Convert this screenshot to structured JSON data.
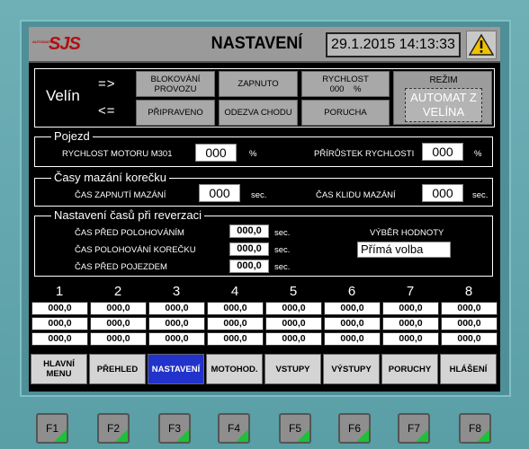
{
  "header": {
    "logo_text": "SJS",
    "logo_small": "AUTOMATION",
    "title": "NASTAVENÍ",
    "datetime": "29.1.2015 14:13:33"
  },
  "control": {
    "velin": "Velín",
    "arrow_right": "=>",
    "arrow_left": "<=",
    "buttons": {
      "blokovani": "BLOKOVÁNÍ PROVOZU",
      "zapnuto": "ZAPNUTO",
      "rychlost_label": "RYCHLOST",
      "rychlost_value": "000",
      "rychlost_unit": "%",
      "pripraveno": "PŘIPRAVENO",
      "odezva": "ODEZVA CHODU",
      "porucha": "PORUCHA"
    },
    "rezim_label": "REŽIM",
    "rezim_value": "AUTOMAT Z VELÍNA"
  },
  "pojezd": {
    "title": "Pojezd",
    "rychlost_label": "RYCHLOST MOTORU M301",
    "rychlost_value": "000",
    "rychlost_unit": "%",
    "prirustek_label": "PŘÍRŮSTEK RYCHLOSTI",
    "prirustek_value": "000",
    "prirustek_unit": "%"
  },
  "casy_mazani": {
    "title": "Časy mazání korečku",
    "zapnuti_label": "ČAS ZAPNUTÍ MAZÁNÍ",
    "zapnuti_value": "000",
    "zapnuti_unit": "sec.",
    "klidu_label": "ČAS KLIDU MAZÁNÍ",
    "klidu_value": "000",
    "klidu_unit": "sec."
  },
  "reverzace": {
    "title": "Nastavení časů při reverzaci",
    "rows": [
      {
        "label": "ČAS PŘED POLOHOVÁNÍM",
        "value": "000,0",
        "unit": "sec."
      },
      {
        "label": "ČAS POLOHOVÁNÍ KOREČKU",
        "value": "000,0",
        "unit": "sec."
      },
      {
        "label": "ČAS PŘED POJEZDEM",
        "value": "000,0",
        "unit": "sec."
      }
    ],
    "vyber_label": "VÝBĚR HODNOTY",
    "vyber_value": "Přímá volba"
  },
  "table": {
    "columns": [
      "1",
      "2",
      "3",
      "4",
      "5",
      "6",
      "7",
      "8"
    ],
    "rows": [
      [
        "000,0",
        "000,0",
        "000,0",
        "000,0",
        "000,0",
        "000,0",
        "000,0",
        "000,0"
      ],
      [
        "000,0",
        "000,0",
        "000,0",
        "000,0",
        "000,0",
        "000,0",
        "000,0",
        "000,0"
      ],
      [
        "000,0",
        "000,0",
        "000,0",
        "000,0",
        "000,0",
        "000,0",
        "000,0",
        "000,0"
      ]
    ]
  },
  "nav": [
    {
      "label": "HLAVNÍ MENU",
      "active": false
    },
    {
      "label": "PŘEHLED",
      "active": false
    },
    {
      "label": "NASTAVENÍ",
      "active": true
    },
    {
      "label": "MOTOHOD.",
      "active": false
    },
    {
      "label": "VSTUPY",
      "active": false
    },
    {
      "label": "VÝSTUPY",
      "active": false
    },
    {
      "label": "PORUCHY",
      "active": false
    },
    {
      "label": "HLÁŠENÍ",
      "active": false
    }
  ],
  "fkeys": [
    "F1",
    "F2",
    "F3",
    "F4",
    "F5",
    "F6",
    "F7",
    "F8"
  ],
  "icons": {
    "warning": "warning-icon"
  },
  "colors": {
    "active_nav": "#2233cc",
    "fkey_indicator": "#1fbf3a",
    "logo": "#b01010"
  }
}
